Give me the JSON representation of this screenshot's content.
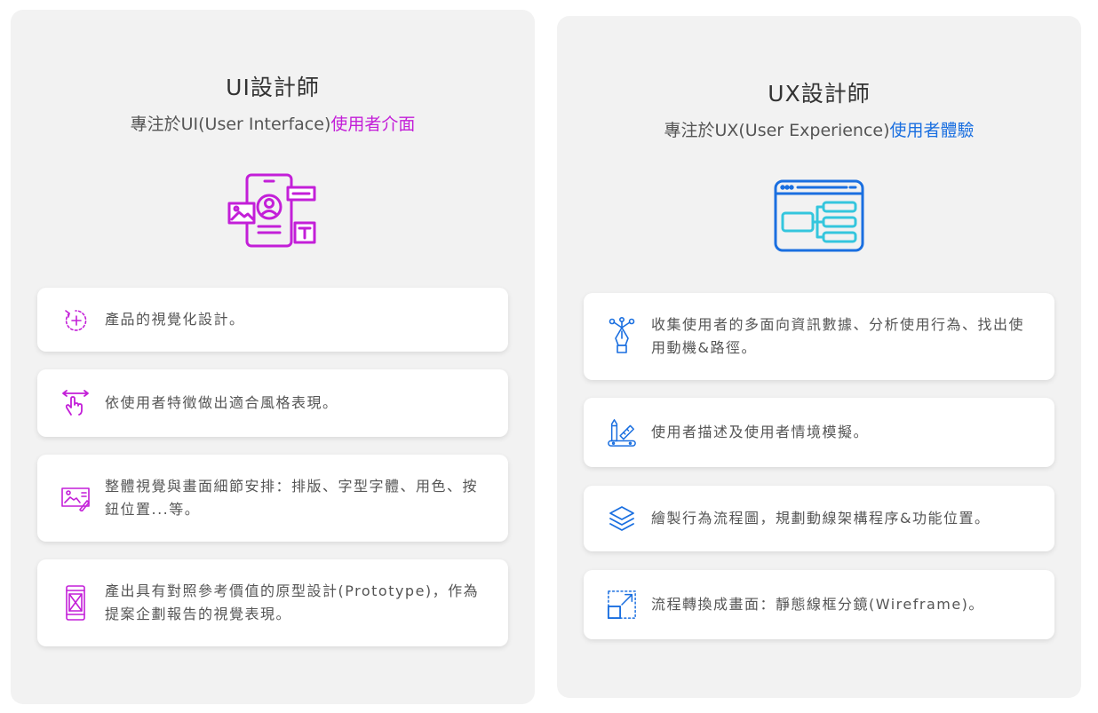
{
  "ui_panel": {
    "title": "UI設計師",
    "subtitle_prefix": "專注於UI(User Interface)",
    "subtitle_accent": "使用者介面",
    "accent_color": "#c31fd8",
    "hero_icon": "mobile-ui-elements-icon",
    "items": [
      {
        "icon": "visual-design-icon",
        "text": "產品的視覺化設計。"
      },
      {
        "icon": "swipe-gesture-icon",
        "text": "依使用者特徵做出適合風格表現。"
      },
      {
        "icon": "image-layout-icon",
        "text": "整體視覺與畫面細節安排：排版、字型字體、用色、按鈕位置...等。"
      },
      {
        "icon": "prototype-phone-icon",
        "text": "產出具有對照參考價值的原型設計(Prototype)，作為提案企劃報告的視覺表現。"
      }
    ]
  },
  "ux_panel": {
    "title": "UX設計師",
    "subtitle_prefix": "專注於UX(User Experience)",
    "subtitle_accent": "使用者體驗",
    "accent_color": "#1a6fe0",
    "hero_icon": "browser-flowchart-icon",
    "items": [
      {
        "icon": "pen-nodes-icon",
        "text": "收集使用者的多面向資訊數據、分析使用行為、找出使用動機&路徑。"
      },
      {
        "icon": "design-tools-icon",
        "text": "使用者描述及使用者情境模擬。"
      },
      {
        "icon": "layers-icon",
        "text": "繪製行為流程圖，規劃動線架構程序&功能位置。"
      },
      {
        "icon": "resize-frame-icon",
        "text": "流程轉換成畫面：靜態線框分鏡(Wireframe)。"
      }
    ]
  }
}
